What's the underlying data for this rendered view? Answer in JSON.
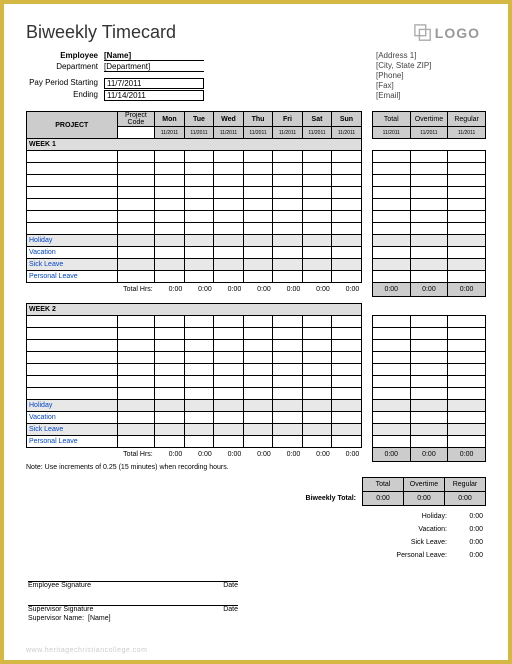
{
  "title": "Biweekly Timecard",
  "logo": "LOGO",
  "header": {
    "employee_label": "Employee",
    "employee_value": "[Name]",
    "department_label": "Department",
    "department_value": "[Department]",
    "paystart_label": "Pay Period Starting",
    "paystart_value": "11/7/2011",
    "ending_label": "Ending",
    "ending_value": "11/14/2011",
    "addr1": "[Address 1]",
    "addr2": "[City, State  ZIP]",
    "phone": "[Phone]",
    "fax": "[Fax]",
    "email": "[Email]"
  },
  "cols": {
    "project": "PROJECT",
    "code": "Project Code",
    "days": [
      "Mon",
      "Tue",
      "Wed",
      "Thu",
      "Fri",
      "Sat",
      "Sun"
    ],
    "dates": [
      "11/2011",
      "11/2011",
      "11/2011",
      "11/2011",
      "11/2011",
      "11/2011",
      "11/2011"
    ],
    "sdates": [
      "11/2011",
      "11/2011",
      "11/2011"
    ],
    "total": "Total",
    "overtime": "Overtime",
    "regular": "Regular"
  },
  "weeks": [
    {
      "label": "WEEK 1",
      "rows": 7,
      "special": [
        "Holiday",
        "Vacation",
        "Sick Leave",
        "Personal Leave"
      ],
      "totals_label": "Total Hrs:",
      "totals": [
        "0:00",
        "0:00",
        "0:00",
        "0:00",
        "0:00",
        "0:00",
        "0:00"
      ],
      "sum": [
        "0:00",
        "0:00",
        "0:00"
      ]
    },
    {
      "label": "WEEK 2",
      "rows": 7,
      "special": [
        "Holiday",
        "Vacation",
        "Sick Leave",
        "Personal Leave"
      ],
      "totals_label": "Total Hrs:",
      "totals": [
        "0:00",
        "0:00",
        "0:00",
        "0:00",
        "0:00",
        "0:00",
        "0:00"
      ],
      "sum": [
        "0:00",
        "0:00",
        "0:00"
      ]
    }
  ],
  "note": "Note: Use increments of 0.25 (15 minutes) when recording hours.",
  "summary": {
    "biweekly_label": "Biweekly Total:",
    "total": "0:00",
    "overtime": "0:00",
    "regular": "0:00"
  },
  "leave": [
    {
      "label": "Holiday:",
      "value": "0:00"
    },
    {
      "label": "Vacation:",
      "value": "0:00"
    },
    {
      "label": "Sick Leave:",
      "value": "0:00"
    },
    {
      "label": "Personal Leave:",
      "value": "0:00"
    }
  ],
  "sig": {
    "emp": "Employee Signature",
    "sup": "Supervisor Signature",
    "date": "Date",
    "supname_label": "Supervisor Name:",
    "supname_value": "[Name]"
  },
  "watermark": "www.heritagechristiancollege.com"
}
